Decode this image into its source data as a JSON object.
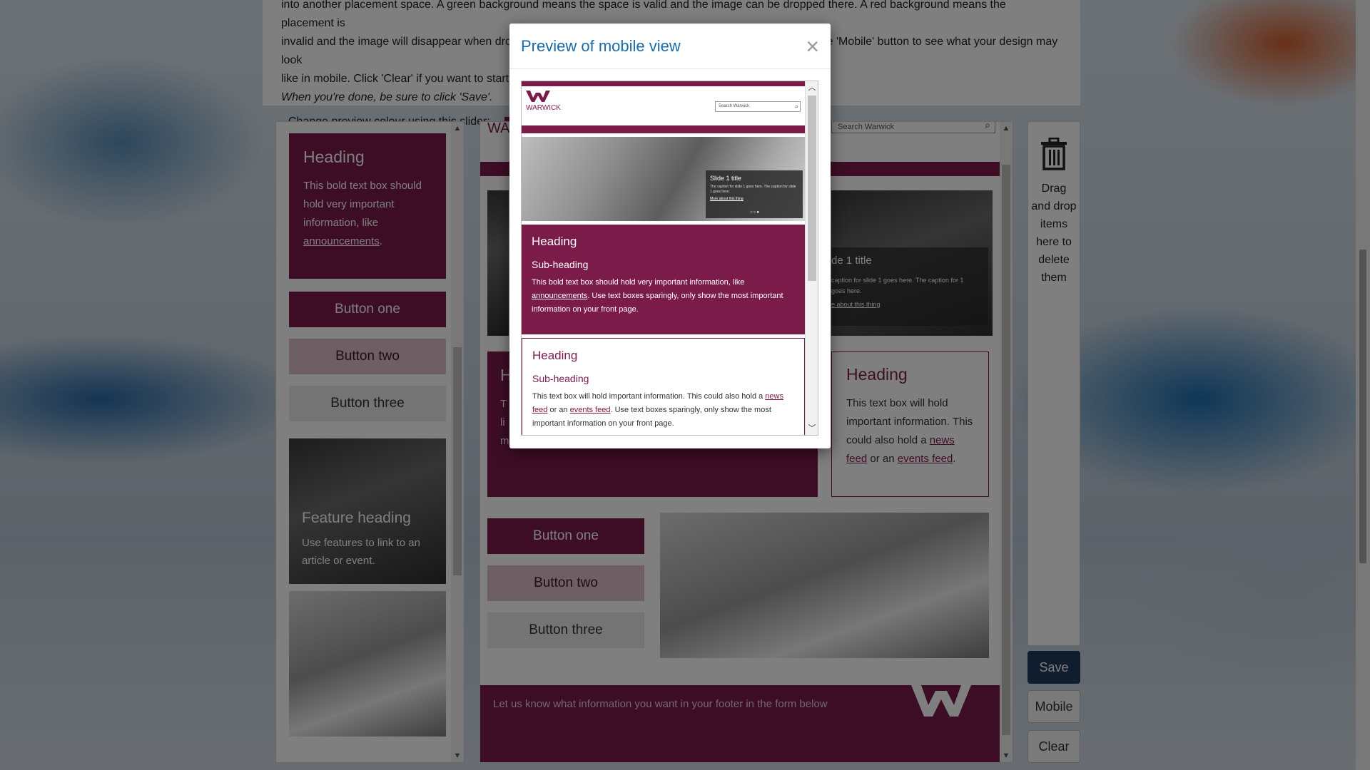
{
  "intro": {
    "line1": "into another placement space. A green background means the space is valid and the image can be dropped there. A red background means the placement is",
    "line2": "invalid and the image will disappear when dropped. To delete an item, drag it into the bin on the right. Use the 'Mobile' button to see what your design may look",
    "line3": "like in mobile. Click 'Clear' if you want to start",
    "line4": "When you're done, be sure to click 'Save'.",
    "slider_label": "Change preview colour using this slider:"
  },
  "palette": {
    "heading": "Heading",
    "body_prefix": "This bold text box should hold very important information, like",
    "body_link": "announcements",
    "body_suffix": ".",
    "button_one": "Button one",
    "button_two": "Button two",
    "button_three": "Button three",
    "feature_heading": "Feature heading",
    "feature_body": "Use features to link to an article or event."
  },
  "canvas": {
    "logo_text": "WA",
    "search_placeholder": "Search Warwick",
    "slide_title": "de 1 title",
    "slide_caption": "caption for slide 1 goes here. The caption for 1 goes here.",
    "slide_link": "e about this thing",
    "heading_partial": "H",
    "text_partial_1": "T",
    "text_partial_2": "li",
    "text_partial_3": "m",
    "side_heading": "Heading",
    "side_body_1": "This text box will hold important information. This could also hold a",
    "side_link_1": "news feed",
    "side_or": " or an ",
    "side_link_2": "events feed",
    "side_end": ".",
    "button_one": "Button one",
    "button_two": "Button two",
    "button_three": "Button three",
    "footer_text": "Let us know what information you want in your footer in the form below"
  },
  "bin": {
    "label": "Drag and drop items here to delete them"
  },
  "actions": {
    "save": "Save",
    "mobile": "Mobile",
    "clear": "Clear"
  },
  "modal": {
    "title": "Preview of mobile view",
    "close": "×",
    "logo_text": "WARWICK",
    "search_placeholder": "Search Warwick",
    "slide_title": "Slide 1 title",
    "slide_caption": "The caption for slide 1 goes here. The caption for slide 1 goes here.",
    "slide_link": "More about this thing",
    "plum": {
      "heading": "Heading",
      "subheading": "Sub-heading",
      "body_prefix": "This bold text box should hold very important information, like",
      "link": "announcements",
      "body_suffix": ". Use text boxes sparingly, only show the most important information on your front page."
    },
    "white": {
      "heading": "Heading",
      "subheading": "Sub-heading",
      "body_prefix": "This text box will hold important information. This could also hold a",
      "link1": "news feed",
      "or": " or an ",
      "link2": "events feed",
      "body_suffix": ". Use text boxes sparingly, only show the most important information on your front page."
    }
  },
  "colors": {
    "brand": "#7a1b4a",
    "title_blue": "#1a6aa8",
    "save_blue": "#1f3a5f"
  }
}
